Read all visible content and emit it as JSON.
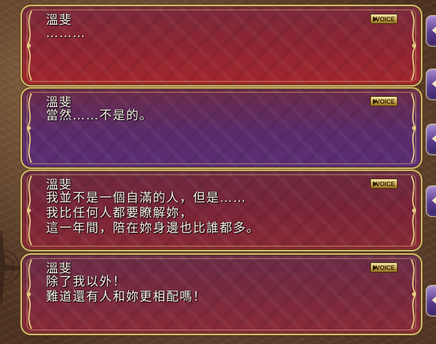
{
  "colors": {
    "red_panel_top": "#7a1a26",
    "red_panel_bottom": "#a8272f",
    "purple_panel_top": "#4b2a5e",
    "purple_panel_bottom": "#5b2d75",
    "text": "#f6f1e6",
    "gold_frame": "#d9bf78"
  },
  "backlog": {
    "entries": [
      {
        "speaker": "溫斐",
        "voice_label": "VOICE",
        "lines": [
          "………"
        ],
        "tint": "red"
      },
      {
        "speaker": "溫斐",
        "voice_label": "VOICE",
        "lines": [
          "當然……不是的。"
        ],
        "tint": "purple"
      },
      {
        "speaker": "溫斐",
        "voice_label": "VOICE",
        "lines": [
          "我並不是一個自滿的人，但是……",
          "我比任何人都要瞭解妳，",
          "這一年間，陪在妳身邊也比誰都多。"
        ],
        "tint": "red"
      },
      {
        "speaker": "溫斐",
        "voice_label": "VOICE",
        "lines": [
          "除了我以外！",
          "難道還有人和妳更相配嗎！"
        ],
        "tint": "red"
      }
    ]
  },
  "side_tabs": [
    {
      "icon": "arrow-left-icon"
    },
    {
      "icon": "arrow-left-icon"
    },
    {
      "icon": "arrow-left-icon"
    },
    {
      "icon": "arrow-left-icon"
    },
    {
      "icon": "arrow-left-icon"
    }
  ]
}
